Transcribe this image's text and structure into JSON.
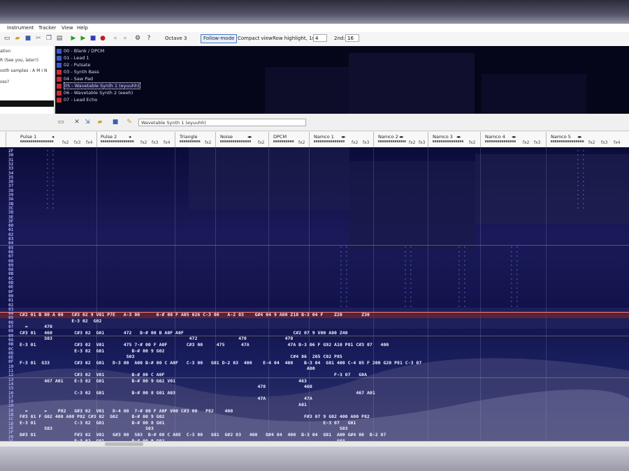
{
  "menu": [
    "Instrument",
    "Tracker",
    "View",
    "Help"
  ],
  "toolbar": {
    "octave_label": "Octave",
    "octave_value": "3",
    "follow_mode": "Follow-mode",
    "compact_view": "Compact view",
    "row_highlight_label": "Row highlight, 1st:",
    "row_highlight_1st": "4",
    "row_highlight_2nd_label": "2nd:",
    "row_highlight_2nd": "16"
  },
  "left_panel": {
    "line1": "ation",
    "line2": "R (See you, later!)",
    "line3": "ooth samples : A M I N",
    "line4": "oss?"
  },
  "instruments": [
    {
      "label": "00 - Blank / DPCM",
      "color": "#3a5ac8"
    },
    {
      "label": "01 - Lead 1",
      "color": "#3a5ac8"
    },
    {
      "label": "02 - Pulsate",
      "color": "#3a5ac8"
    },
    {
      "label": "03 - Synth Bass",
      "color": "#c83030"
    },
    {
      "label": "04 - Saw Pad",
      "color": "#c83030"
    },
    {
      "label": "05 - Wavetable Synth 1 (eyuuhh)",
      "color": "#c83030",
      "selected": true
    },
    {
      "label": "06 - Wavetable Synth 2 (eeeh)",
      "color": "#c83030"
    },
    {
      "label": "07 - Lead Echo",
      "color": "#c83030"
    }
  ],
  "instrument_name_field": "Wavetable Synth 1 (eyuuhh)",
  "channels": [
    {
      "name": "Pulse 1",
      "fx": [
        "fx2",
        "fx3",
        "fx4"
      ]
    },
    {
      "name": "Pulse 2",
      "fx": [
        "fx2",
        "fx3",
        "fx4"
      ]
    },
    {
      "name": "Triangle",
      "fx": [
        "fx2"
      ]
    },
    {
      "name": "Noise",
      "fx": [
        "fx2"
      ]
    },
    {
      "name": "DPCM",
      "fx": [
        "fx2"
      ]
    },
    {
      "name": "Namco 1",
      "fx": [
        "fx2",
        "fx3"
      ]
    },
    {
      "name": "Namco 2",
      "fx": [
        "fx2",
        "fx3"
      ]
    },
    {
      "name": "Namco 3",
      "fx": [
        "fx2"
      ]
    },
    {
      "name": "Namco 4",
      "fx": [
        "fx2",
        "fx3"
      ]
    },
    {
      "name": "Namco 5",
      "fx": [
        "fx2",
        "fx3",
        "fx4"
      ]
    }
  ],
  "row_numbers": [
    "2F",
    "30",
    "31",
    "32",
    "33",
    "34",
    "35",
    "36",
    "37",
    "38",
    "39",
    "3A",
    "3B",
    "3C",
    "3D",
    "3E",
    "3F",
    "00",
    "01",
    "02",
    "03",
    "04",
    "05",
    "06",
    "07",
    "08",
    "09",
    "0A",
    "0B",
    "0C",
    "0D",
    "0E",
    "0F",
    "00",
    "01",
    "02",
    "03",
    "04",
    "05",
    "06",
    "07",
    "08",
    "09",
    "0A",
    "0B",
    "0C",
    "0D",
    "0E",
    "0F",
    "10",
    "11",
    "12",
    "13",
    "14",
    "15",
    "16",
    "17",
    "18",
    "19",
    "1A",
    "1B",
    "1C",
    "1D",
    "1E",
    "1F",
    "20",
    "21"
  ],
  "pattern_rows": [
    {
      "row": "00",
      "text": "C#2 01 B 00 A 00   C#3 02 9 V01 P7E   A-3 00      6-# 00 F A05 026 C-3 00   A-2 03    G#4 04 9 A00 Z10 B-3 04 F    Z20       Z30"
    },
    {
      "row": "01",
      "text": "                   E-3 02  G02"
    },
    {
      "row": "02",
      "text": "  =      470"
    },
    {
      "row": "03",
      "text": "C#3 01   460        C#3 02  G01       472   B-# 00 B A0F A0F                                        C#2 07 9 V00 A00 Z40"
    },
    {
      "row": "04",
      "text": "         S03                                                  472               470              470"
    },
    {
      "row": "05",
      "text": "E-3 01              C#3 02  V01       475 7-# 00 F A0F       C#3 00     475      47A              47A B-3 06 F G92 A10 P81 C#3 07   400"
    },
    {
      "row": "06",
      "text": "                    E-3 02  G01          B-# 00 9 G02"
    },
    {
      "row": "07",
      "text": "                                       S03                                                         C#4 06  205 C02 P85"
    },
    {
      "row": "08",
      "text": "F-3 01  G33         C#3 02  G01   D-3 00  A00 B-# 00 C A0F   C-3 00   G01 D-2 03  400    E-4 04  400    B-3 04  G81 400 C-4 05 F 200 G20 P81 C-3 07"
    },
    {
      "row": "09",
      "text": "                                                                                                         A00"
    },
    {
      "row": "0A",
      "text": "                    C#3 02  V01          B-# 00 C A0F                                                              F-3 07   G0A"
    },
    {
      "row": "0B",
      "text": "         467 A01    E-3 02  G01          B-# 00 9 G02 V01                                             463"
    },
    {
      "row": "0C",
      "text": "                                                                                       478              460"
    },
    {
      "row": "0D",
      "text": "                    C-3 02  G01          B-# 00 8 G01 A03                                                                  467 A01"
    },
    {
      "row": "0E",
      "text": "                                                                                       47A              47A"
    },
    {
      "row": "0F",
      "text": "                                                                                                      A01"
    },
    {
      "row": "10",
      "text": "  =      =    P82   G#3 02  V01   D-4 00  7-# 00 F A0F V00 C#3 00   P82    400"
    },
    {
      "row": "11",
      "text": "F#3 01 F G02 400 A00 P82 C#3 02  G02     B-# 00 9 G02                                                   F#3 07 9 G02 400 A00 P82"
    },
    {
      "row": "12",
      "text": "E-3 01              C-3 02  G01          B-# 00 8 G01                                                          E-3 07   G01"
    },
    {
      "row": "13",
      "text": "         S03                                  S03                                                                    S03"
    },
    {
      "row": "14",
      "text": "D#3 01              F#3 02  V01   G#3 00  S03  B-# 00 C A0E  C-3 00   G01  G#2 03   400   D#4 04  400  B-3 04  G01  A00 G#4 06  B-2 07"
    },
    {
      "row": "15",
      "text": "                    E-3 02  G01          B-# 00 9 G02                                                               S03"
    }
  ]
}
